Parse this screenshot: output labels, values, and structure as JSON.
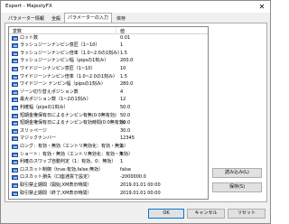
{
  "window": {
    "title": "Expert - MajestyFX",
    "close_glyph": "✕"
  },
  "tabs": [
    {
      "label": "パラメーター情報"
    },
    {
      "label": "全般"
    },
    {
      "label": "パラメーターの入力"
    },
    {
      "label": "依存"
    }
  ],
  "table": {
    "columns": [
      "変数",
      "値"
    ],
    "rows": [
      {
        "name": "ロット数",
        "value": "0.01"
      },
      {
        "name": "ラッシュジーンナンピン意匠（1~10）",
        "value": "1"
      },
      {
        "name": "ラッシュジーンナンピン倍率（1.0~2.0の1刻み）",
        "value": "1.5"
      },
      {
        "name": "ラッシュジーンナンピン幅（pipsの1刻み）",
        "value": "200.0"
      },
      {
        "name": "ワイドジーンナンピン意匠（1~10）",
        "value": "10"
      },
      {
        "name": "ワイドジーンナンピン倍率（1.0~2.0の1刻み）",
        "value": "1.5"
      },
      {
        "name": "ワイドジーン ナンピン幅（pipsの1刻み）",
        "value": "280.0"
      },
      {
        "name": "ゾーン切り替えポジション数",
        "value": "4"
      },
      {
        "name": "最大ポジション数（1~2の1刻み）",
        "value": "12"
      },
      {
        "name": "利確幅（pipsの1刻み）",
        "value": "50.0"
      },
      {
        "name": "短期金権保有日によるナンピン有無(0:0無有効)",
        "value": "50.0"
      },
      {
        "name": "短期金権保有日によるナンピン有効時間(0:0無有効)",
        "value": "50.0"
      },
      {
        "name": "スリッページ",
        "value": "30.0"
      },
      {
        "name": "マジックナンバー",
        "value": "12345"
      },
      {
        "name": "ロング：有効・無効（エントリ無効化：有効・無効）",
        "value": "1"
      },
      {
        "name": "ショート：有効・無効（エントリ無効化：有効・無効）",
        "value": "1"
      },
      {
        "name": "利確のスワップ自動判定（1：有効、0：無効）",
        "value": "1"
      },
      {
        "name": "ロスカット制御（true:有効,false:無効）",
        "value": "false"
      },
      {
        "name": "ロスカット損失（口座通貨で設定）",
        "value": "-2000000.0"
      },
      {
        "name": "取引禁止期間（開始;XM表示時間）",
        "value": "2019.01.01 00:00"
      },
      {
        "name": "取引禁止期間（終了;XM表示時間）",
        "value": "2019.01.01 00:00"
      }
    ]
  },
  "side_buttons": {
    "load": "読み込み(L)",
    "save": "保存(S)"
  },
  "footer": {
    "ok": "OK",
    "cancel": "キャンセル",
    "reset": "リセット"
  }
}
